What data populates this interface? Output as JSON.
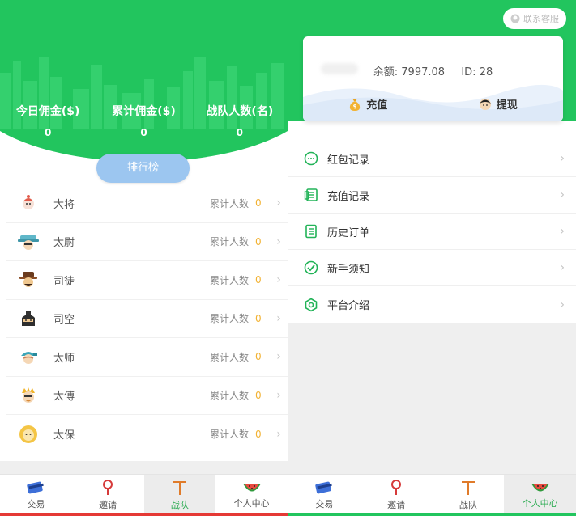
{
  "left": {
    "stats": [
      {
        "label": "今日佣金($)",
        "value": "0"
      },
      {
        "label": "累计佣金($)",
        "value": "0"
      },
      {
        "label": "战队人数(名)",
        "value": "0"
      }
    ],
    "ranking_button": "排行榜",
    "rank_count_label": "累计人数",
    "ranks": [
      {
        "name": "大将",
        "count": "0",
        "icon": "general-avatar-icon"
      },
      {
        "name": "太尉",
        "count": "0",
        "icon": "marshal-avatar-icon"
      },
      {
        "name": "司徒",
        "count": "0",
        "icon": "minister-avatar-icon"
      },
      {
        "name": "司空",
        "count": "0",
        "icon": "works-avatar-icon"
      },
      {
        "name": "太师",
        "count": "0",
        "icon": "grand-tutor-avatar-icon"
      },
      {
        "name": "太傅",
        "count": "0",
        "icon": "grand-mentor-avatar-icon"
      },
      {
        "name": "太保",
        "count": "0",
        "icon": "grand-protector-avatar-icon"
      }
    ],
    "nav": [
      {
        "label": "交易",
        "icon": "card-icon"
      },
      {
        "label": "邀请",
        "icon": "pin-icon"
      },
      {
        "label": "战队",
        "icon": "team-icon",
        "active": true
      },
      {
        "label": "个人中心",
        "icon": "watermelon-icon"
      }
    ]
  },
  "right": {
    "contact_button": "联系客服",
    "balance_label": "余额:",
    "balance_value": "7997.08",
    "id_label": "ID:",
    "id_value": "28",
    "recharge_label": "充值",
    "withdraw_label": "提现",
    "menu": [
      {
        "label": "红包记录",
        "icon": "chat-bubble-icon"
      },
      {
        "label": "充值记录",
        "icon": "receipt-icon"
      },
      {
        "label": "历史订单",
        "icon": "document-icon"
      },
      {
        "label": "新手须知",
        "icon": "check-circle-icon"
      },
      {
        "label": "平台介绍",
        "icon": "settings-icon"
      }
    ],
    "nav": [
      {
        "label": "交易",
        "icon": "card-icon"
      },
      {
        "label": "邀请",
        "icon": "pin-icon"
      },
      {
        "label": "战队",
        "icon": "team-icon"
      },
      {
        "label": "个人中心",
        "icon": "watermelon-icon",
        "active": true
      }
    ]
  },
  "colors": {
    "primary_green": "#22c55e",
    "rank_button": "#9cc6f0",
    "count_orange": "#f2b233",
    "active_green": "#22a84a"
  }
}
